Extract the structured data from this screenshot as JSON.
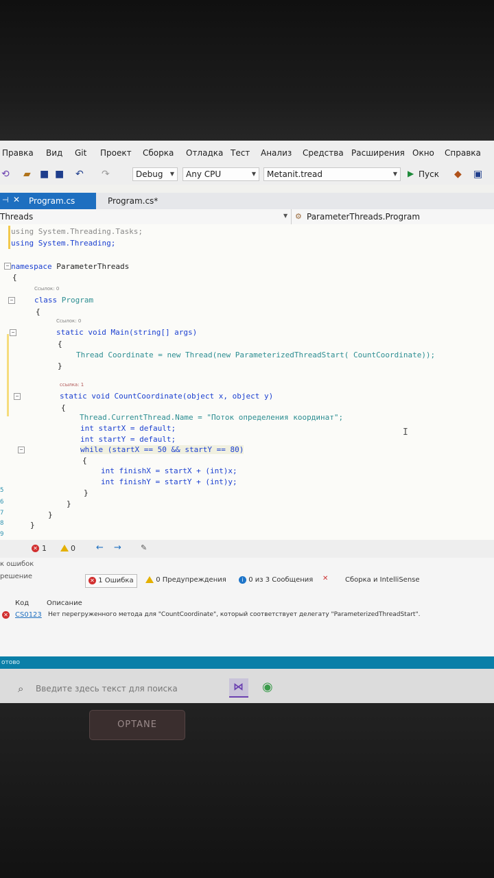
{
  "menu": [
    "Правка",
    "Вид",
    "Git",
    "Проект",
    "Сборка",
    "Отладка",
    "Тест",
    "Анализ",
    "Средства",
    "Расширения",
    "Окно",
    "Справка"
  ],
  "toolbar": {
    "config": "Debug",
    "platform": "Any CPU",
    "project": "Metanit.tread",
    "run_label": "Пуск"
  },
  "tabs": {
    "active": "Program.cs",
    "inactive": "Program.cs*"
  },
  "nav": {
    "left": "Threads",
    "right": "ParameterThreads.Program"
  },
  "code": {
    "l1": "using System.Threading.Tasks;",
    "l2": "using System.Threading;",
    "ns_kw": "namespace",
    "ns_name": "ParameterThreads",
    "brace_open": "{",
    "brace_close": "}",
    "ref0": "Ссылок: 0",
    "ref1": "ссылка: 1",
    "class_kw": "class",
    "class_name": "Program",
    "main_sig": "static void Main(string[] args)",
    "thread_line": "Thread Coordinate = new Thread(new ParameterizedThreadStart( CountCoordinate));",
    "count_sig": "static void CountCoordinate(object x, object y)",
    "name_line": "Thread.CurrentThread.Name = \"Поток определения координат\";",
    "startx": "int startX = default;",
    "starty": "int startY = default;",
    "while_line": "while (startX == 50 && startY == 80)",
    "finishx": "int finishX = startX + (int)x;",
    "finishy": "int finishY = startY + (int)y;",
    "cursor": "I"
  },
  "line_numbers": [
    "5",
    "6",
    "7",
    "8",
    "9",
    "0"
  ],
  "mini_status": {
    "errors": "1",
    "warnings": "0"
  },
  "error_list": {
    "side1": "к ошибок",
    "side2": "решение",
    "errors_chip": "1 Ошибка",
    "warnings_chip": "0 Предупреждения",
    "messages_chip": "0 из 3 Сообщения",
    "build_filter": "Сборка и IntelliSense",
    "col_code": "Код",
    "col_desc": "Описание",
    "err_code": "CS0123",
    "err_desc": "Нет перегруженного метода для \"CountCoordinate\", который соответствует делегату \"ParameterizedThreadStart\"."
  },
  "status": "отово",
  "taskbar": {
    "search_placeholder": "Введите здесь текст для поиска"
  },
  "sticker": "OPTANE",
  "colors": {
    "keyword": "#1a3fd0",
    "type": "#2b8d91",
    "string": "#a31515",
    "status_bar": "#0a7fa8",
    "active_tab": "#1e6fc0",
    "error": "#d12f2f"
  }
}
